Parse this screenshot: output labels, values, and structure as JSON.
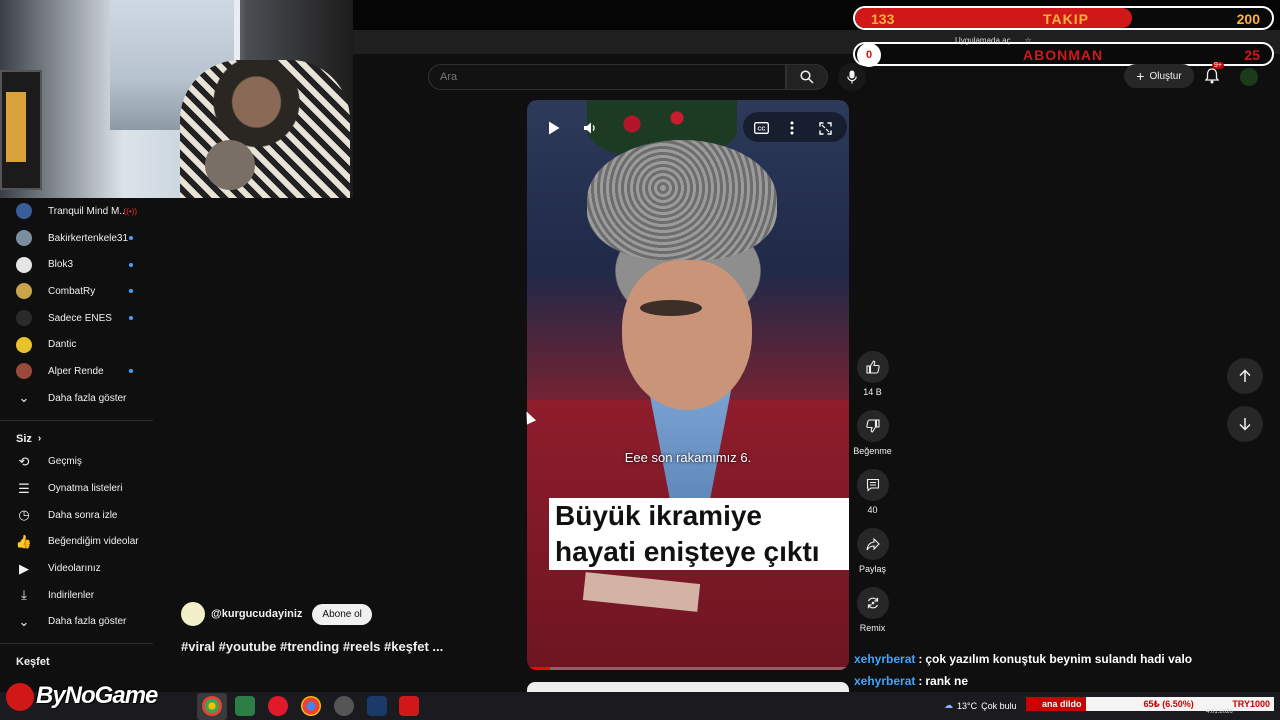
{
  "overlay": {
    "takip": {
      "current": "133",
      "label": "TAKIP",
      "goal": "200",
      "progress": 0.665,
      "color": "#d01818"
    },
    "abonman": {
      "current": "0",
      "label": "ABONMAN",
      "goal": "25",
      "progress": 0.0,
      "color": "#d01818"
    },
    "toolbar_text": "Uygulamada aç"
  },
  "header": {
    "search_placeholder": "Ara",
    "create_label": "Oluştur",
    "notification_badge": "9+"
  },
  "sidebar": {
    "subscriptions": [
      {
        "label": "Tranquil Mind M...",
        "indicator": "live",
        "avatar_color": "#3b5e9a"
      },
      {
        "label": "Bakirkertenkele31",
        "indicator": "dot",
        "avatar_color": "#7a8ea0"
      },
      {
        "label": "Blok3",
        "indicator": "dot",
        "avatar_color": "#e6e6e6"
      },
      {
        "label": "CombatRy",
        "indicator": "dot",
        "avatar_color": "#c9a44a"
      },
      {
        "label": "Sadece ENES",
        "indicator": "dot",
        "avatar_color": "#2b2b2b"
      },
      {
        "label": "Dantic",
        "indicator": "none",
        "avatar_color": "#e9c22b"
      },
      {
        "label": "Alper Rende",
        "indicator": "dot",
        "avatar_color": "#9a4a3a"
      }
    ],
    "show_more_1": "Daha fazla göster",
    "siz_title": "Siz",
    "you_items": [
      {
        "label": "Geçmiş",
        "icon": "history-icon",
        "glyph": "⟲"
      },
      {
        "label": "Oynatma listeleri",
        "icon": "playlists-icon",
        "glyph": "☰"
      },
      {
        "label": "Daha sonra izle",
        "icon": "watch-later-icon",
        "glyph": "◷"
      },
      {
        "label": "Beğendiğim videolar",
        "icon": "liked-icon",
        "glyph": "👍"
      },
      {
        "label": "Videolarınız",
        "icon": "your-videos-icon",
        "glyph": "▶"
      },
      {
        "label": "İndirilenler",
        "icon": "downloads-icon",
        "glyph": "⤓"
      }
    ],
    "show_more_2": "Daha fazla göster",
    "kesfet_title": "Keşfet"
  },
  "video": {
    "subtitle": "Eee son rakamımız 6.",
    "caption_line1": "Büyük ikramiye",
    "caption_line2": "hayati enişteye çıktı",
    "progress": 0.07
  },
  "channel": {
    "handle": "@kurgucudayiniz",
    "subscribe_label": "Abone ol",
    "hashtags": "#viral #youtube #trending #reels #keşfet ..."
  },
  "actions": {
    "likes": "14 B",
    "dislike_label": "Beğenme",
    "comments": "40",
    "share_label": "Paylaş",
    "remix_label": "Remix"
  },
  "chat": [
    {
      "user": "xehyrberat",
      "message": "çok yazılım konuştuk beynim sulandı hadi valo"
    },
    {
      "user": "xehyrberat",
      "message": "rank ne"
    }
  ],
  "taskbar": {
    "logo_text": "ByNoGame",
    "weather_temp": "13°C",
    "weather_text": "Çok bulu",
    "ticker_name": "ana dildo",
    "ticker_price": "65₺ (6.50%)",
    "ticker_currency": "TRY1000",
    "date": "4.01.2026"
  }
}
